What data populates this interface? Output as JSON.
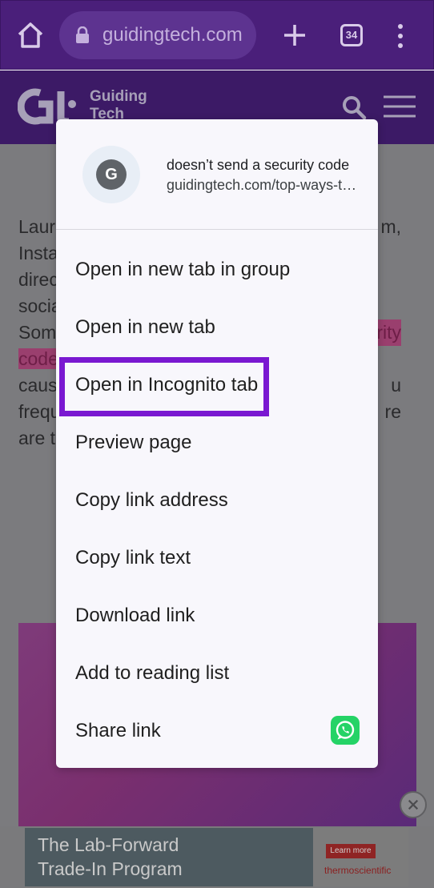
{
  "browser": {
    "url": "guidingtech.com",
    "tab_count": "34"
  },
  "site": {
    "name_line1": "Guiding",
    "name_line2": "Tech"
  },
  "article": {
    "lines": [
      {
        "left": "Laur",
        "right": "m,"
      },
      {
        "left": "Insta",
        "right": ""
      },
      {
        "left": "direc",
        "right": ""
      },
      {
        "left": "socia",
        "right": ""
      },
      {
        "left": "Som",
        "right": "rity"
      },
      {
        "left": "code",
        "right": ""
      },
      {
        "left": "caus",
        "right": "u"
      },
      {
        "left": "frequ",
        "right": "re"
      },
      {
        "left": "are t",
        "right": ""
      }
    ]
  },
  "context_menu": {
    "link_title": "doesn’t send a security code",
    "link_url": "guidingtech.com/top-ways-t…",
    "favicon_letter": "G",
    "items": [
      {
        "label": "Open in new tab in group"
      },
      {
        "label": "Open in new tab"
      },
      {
        "label": "Open in Incognito tab"
      },
      {
        "label": "Preview page"
      },
      {
        "label": "Copy link address"
      },
      {
        "label": "Copy link text"
      },
      {
        "label": "Download link"
      },
      {
        "label": "Add to reading list"
      },
      {
        "label": "Share link"
      }
    ],
    "highlighted_item": "Open in Incognito tab",
    "share_icon": "whatsapp-icon"
  },
  "ad": {
    "line1": "The Lab-Forward",
    "line2": "Trade-In Program",
    "button": "Learn more",
    "brand": "thermoscientific"
  },
  "colors": {
    "toolbar": "#4a1f7a",
    "highlight_box": "#7a18d1",
    "whatsapp": "#25d366"
  }
}
